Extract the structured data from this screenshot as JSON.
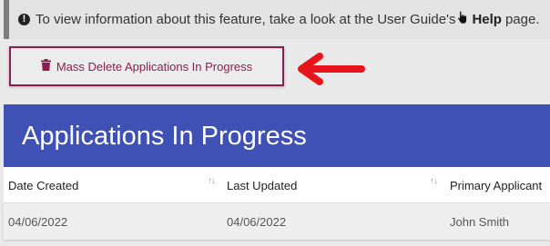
{
  "info": {
    "text": "To view information about this feature, take a look at the User Guide's",
    "help_label": "Help",
    "suffix": "page."
  },
  "actions": {
    "mass_delete_label": "Mass Delete Applications In Progress"
  },
  "panel": {
    "title": "Applications In Progress"
  },
  "table": {
    "columns": [
      "Date Created",
      "Last Updated",
      "Primary Applicant"
    ],
    "rows": [
      [
        "04/06/2022",
        "04/06/2022",
        "John Smith"
      ]
    ]
  },
  "colors": {
    "header_bg": "#3f51b5",
    "button_border": "#8b1e4f",
    "arrow": "#e8141c"
  },
  "icons": {
    "info": "info-circle-icon",
    "hand": "hand-pointer-icon",
    "trash": "trash-icon",
    "arrow": "red-arrow-icon",
    "sort": "sort-icon"
  }
}
